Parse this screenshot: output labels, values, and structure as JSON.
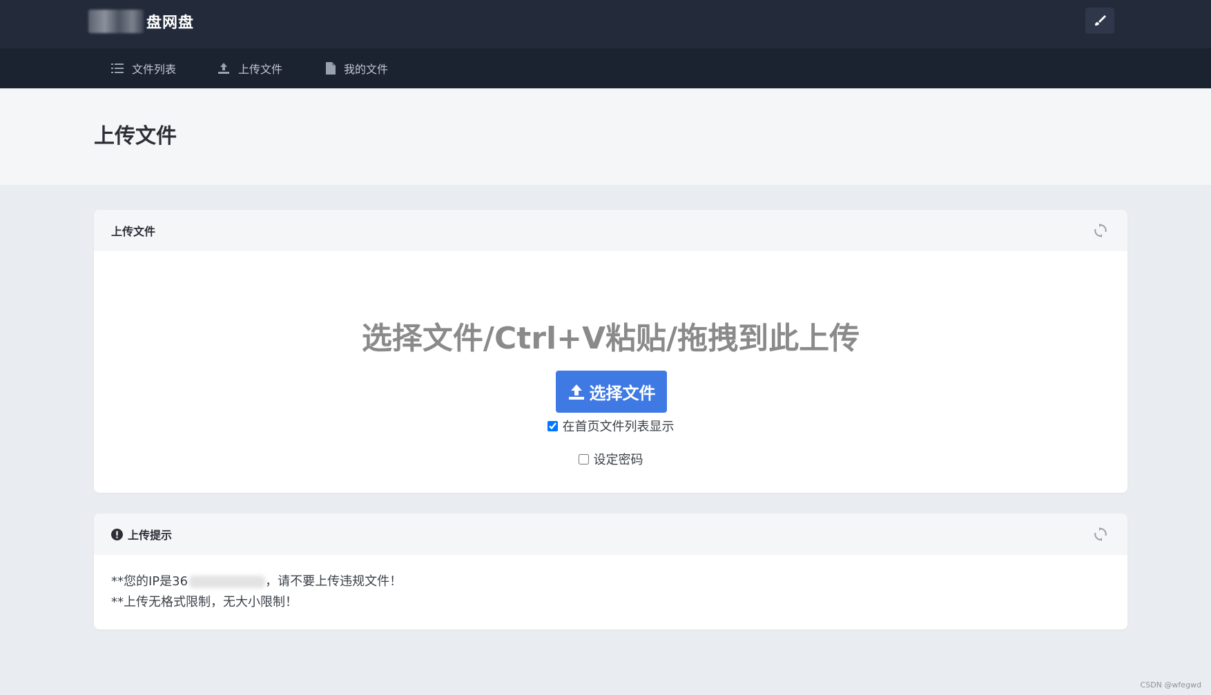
{
  "header": {
    "brand_suffix": "盘网盘"
  },
  "nav": {
    "items": [
      {
        "label": "文件列表",
        "icon": "list-icon"
      },
      {
        "label": "上传文件",
        "icon": "upload-icon"
      },
      {
        "label": "我的文件",
        "icon": "file-icon"
      }
    ]
  },
  "page": {
    "title": "上传文件"
  },
  "upload_card": {
    "title": "上传文件",
    "hint": "选择文件/Ctrl+V粘贴/拖拽到此上传",
    "choose_label": "选择文件",
    "show_in_list_label": "在首页文件列表显示",
    "show_in_list_checked": true,
    "password_label": "设定密码",
    "password_checked": false
  },
  "tips_card": {
    "title": "上传提示",
    "line1_prefix": "**您的IP是36",
    "line1_suffix": "，请不要上传违规文件！",
    "line2": "**上传无格式限制，无大小限制！"
  },
  "watermark": "CSDN @wfegwd"
}
